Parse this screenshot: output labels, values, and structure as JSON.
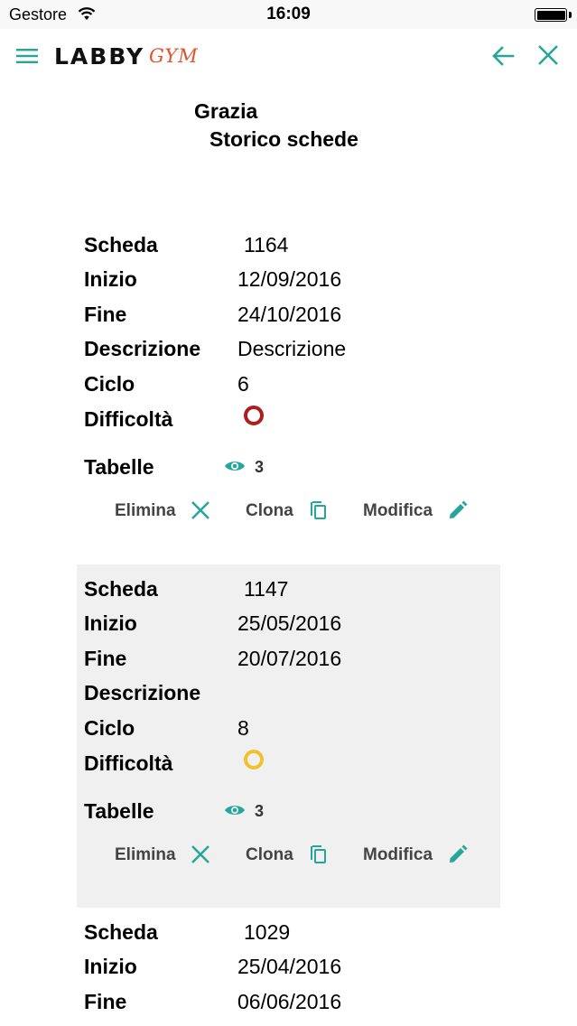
{
  "status_bar": {
    "carrier": "Gestore",
    "time": "16:09"
  },
  "app_bar": {
    "logo_main": "LABBY",
    "logo_sub": "GYM",
    "icons": [
      "menu-icon",
      "arrow-back-icon",
      "close-icon"
    ]
  },
  "header": {
    "user_name": "Grazia",
    "title": "Storico schede"
  },
  "colors": {
    "accent": "#26a69a",
    "logo_accent": "#e0542b",
    "difficulty_red": "#b01c1c",
    "difficulty_yellow": "#f2c12e",
    "card_shade": "#f0f0f0"
  },
  "labels": {
    "scheda": "Scheda",
    "inizio": "Inizio",
    "fine": "Fine",
    "descrizione": "Descrizione",
    "ciclo": "Ciclo",
    "difficolta": "Difficoltà",
    "tabelle": "Tabelle",
    "elimina": "Elimina",
    "clona": "Clona",
    "modifica": "Modifica"
  },
  "cards": [
    {
      "scheda": "1164",
      "inizio": "12/09/2016",
      "fine": "24/10/2016",
      "descrizione": "Descrizione",
      "ciclo": "6",
      "difficolta_color": "#b01c1c",
      "tabelle_count": "3"
    },
    {
      "scheda": "1147",
      "inizio": "25/05/2016",
      "fine": "20/07/2016",
      "descrizione": "",
      "ciclo": "8",
      "difficolta_color": "#f2c12e",
      "tabelle_count": "3"
    },
    {
      "scheda": "1029",
      "inizio": "25/04/2016",
      "fine": "06/06/2016"
    }
  ]
}
